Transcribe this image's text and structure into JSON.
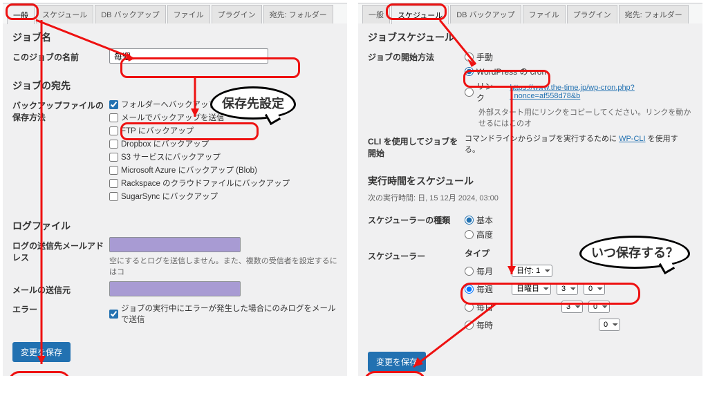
{
  "left": {
    "tabs": [
      "一般",
      "スケジュール",
      "DB バックアップ",
      "ファイル",
      "プラグイン",
      "宛先: フォルダー"
    ],
    "active_tab": 0,
    "job_name_heading": "ジョブ名",
    "job_name_label": "このジョブの名前",
    "job_name_value": "毎週",
    "dest_heading": "ジョブの宛先",
    "backup_method_label": "バックアップファイルの保存方法",
    "options": [
      "フォルダーへバックアップ",
      "メールでバックアップを送信",
      "FTP にバックアップ",
      "Dropbox にバックアップ",
      "S3 サービスにバックアップ",
      "Microsoft Azure にバックアップ (Blob)",
      "Rackspace のクラウドファイルにバックアップ",
      "SugarSync にバックアップ"
    ],
    "log_heading": "ログファイル",
    "log_email_label": "ログの送信先メールアドレス",
    "log_email_note": "空にするとログを送信しません。また、複数の受信者を設定するにはコ",
    "sender_label": "メールの送信元",
    "error_label": "エラー",
    "error_chk": "ジョブの実行中にエラーが発生した場合にのみログをメールで送信",
    "save_btn": "変更を保存"
  },
  "right": {
    "tabs": [
      "一般",
      "スケジュール",
      "DB バックアップ",
      "ファイル",
      "プラグイン",
      "宛先: フォルダー"
    ],
    "active_tab": 1,
    "sched_heading": "ジョブスケジュール",
    "start_label": "ジョブの開始方法",
    "start_manual": "手動",
    "start_cron": "WordPress の cron",
    "start_link": "リンク",
    "link_url": "https://www.the-time.jp/wp-cron.php?_nonce=af558d78&b",
    "link_note": "外部スタート用にリンクをコピーしてください。リンクを動かせるにはこのオ",
    "cli_label": "CLI を使用してジョブを開始",
    "cli_text_a": "コマンドラインからジョブを実行するために ",
    "cli_link": "WP-CLI",
    "cli_text_b": " を使用する。",
    "runtime_heading": "実行時間をスケジュール",
    "next_run": "次の実行時間: 日, 15 12月 2024, 03:00",
    "sched_type_label": "スケジューラーの種類",
    "basic": "基本",
    "advanced": "高度",
    "scheduler_label": "スケジューラー",
    "type_label": "タイプ",
    "monthly": "毎月",
    "weekly": "毎週",
    "daily": "毎日",
    "hourly": "毎時",
    "sel_day": "日付: 1",
    "sel_weekday": "日曜日",
    "sel_3": "3",
    "sel_0": "0",
    "save_btn": "変更を保存"
  },
  "bubbles": {
    "left": "保存先設定",
    "right": "いつ保存する？"
  }
}
